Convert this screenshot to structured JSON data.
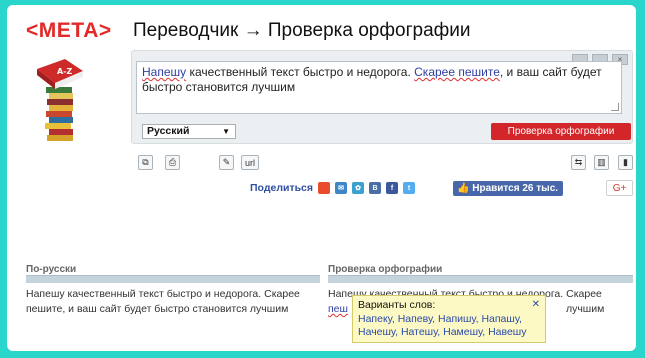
{
  "logo": "<МЕТА>",
  "title": "Переводчик → Проверка орфографии",
  "input": {
    "words": [
      {
        "t": "Напешу",
        "err": true
      },
      {
        "t": " качественный текст быстро и недорога. ",
        "err": false
      },
      {
        "t": "Скарее пешите",
        "err": true
      },
      {
        "t": ", и ваш сайт будет быстро становится лучшим",
        "err": false
      }
    ]
  },
  "language": "Русский",
  "check_button": "Проверка орфографии",
  "tools": {
    "url_label": "url"
  },
  "share": {
    "label": "Поделиться",
    "like_text": "Нравится 26 тыс.",
    "gplus": "G+"
  },
  "columns": {
    "left_header": "По-русски",
    "right_header": "Проверка орфографии",
    "left_text": "Напешу качественный текст быстро и недорога. Скарее пешите, и ваш сайт будет быстро становится лучшим",
    "right_text_line1": "Напешу качественный текст быстро и недорога. Скарее",
    "right_text_line2_start": "пеш",
    "right_text_line2_end": "лучшим"
  },
  "popup": {
    "title": "Варианты слов:",
    "line1": "Напеку, Напеву, Напишу, Напашу,",
    "line2": "Начешу, Натешу, Намешу, Навешу",
    "close": "✕"
  },
  "colors": {
    "brand": "#e32a2a",
    "button": "#d3262a",
    "share": "#2f4fa0",
    "border": "#2ad6cc"
  }
}
